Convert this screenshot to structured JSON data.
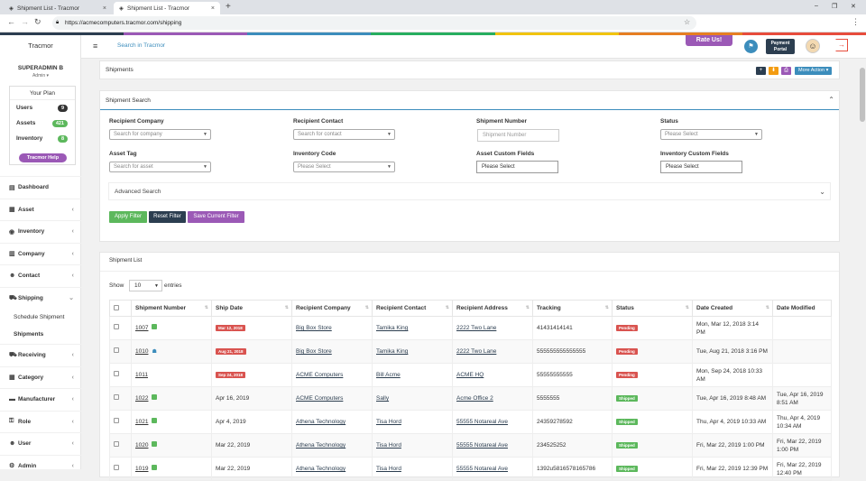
{
  "browser": {
    "tabs": [
      {
        "title": "Shipment List - Tracmor",
        "close": "×"
      },
      {
        "title": "Shipment List - Tracmor",
        "close": "×"
      }
    ],
    "new_tab": "+",
    "url": "https://acmecomputers.tracmor.com/shipping",
    "window_controls": [
      "–",
      "❐",
      "✕"
    ]
  },
  "sidebar": {
    "brand": "Tracmor",
    "user_name": "SUPERADMIN B",
    "user_role": "Admin ▾",
    "plan": {
      "title": "Your Plan",
      "items": [
        {
          "label": "Users",
          "count": "9"
        },
        {
          "label": "Assets",
          "count": "421"
        },
        {
          "label": "Inventory",
          "count": "8"
        }
      ],
      "help_label": "Tracmor Help"
    },
    "nav": [
      {
        "label": "Dashboard",
        "icon": "▤"
      },
      {
        "label": "Asset",
        "icon": "▦"
      },
      {
        "label": "Inventory",
        "icon": "◉"
      },
      {
        "label": "Company",
        "icon": "▥"
      },
      {
        "label": "Contact",
        "icon": "☻"
      },
      {
        "label": "Shipping",
        "icon": "⛟"
      }
    ],
    "shipping_sub": [
      "Schedule Shipment",
      "Shipments"
    ],
    "nav2": [
      {
        "label": "Receiving",
        "icon": "⛟"
      },
      {
        "label": "Category",
        "icon": "▦"
      },
      {
        "label": "Manufacturer",
        "icon": "▬"
      },
      {
        "label": "Role",
        "icon": "⚿"
      },
      {
        "label": "User",
        "icon": "☻"
      },
      {
        "label": "Admin",
        "icon": "⚙"
      }
    ]
  },
  "header": {
    "search": "Search in Tracmor",
    "rate_us": "Rate Us!",
    "payment_portal": "Payment Portal"
  },
  "shipments_bar": {
    "title": "Shipments",
    "more_action": "More Action ▾",
    "action_icons": [
      "+",
      "⬇",
      "⎙",
      "▬"
    ],
    "colors": [
      "#2c3e50",
      "#f39c12",
      "#9b59b6",
      "#9b59b6"
    ]
  },
  "search_panel": {
    "title": "Shipment Search",
    "fields": {
      "recipient_company": {
        "label": "Recipient Company",
        "placeholder": "Search for company"
      },
      "recipient_contact": {
        "label": "Recipient Contact",
        "placeholder": "Search for contact"
      },
      "shipment_number": {
        "label": "Shipment Number",
        "placeholder": "Shipment Number"
      },
      "status": {
        "label": "Status",
        "placeholder": "Please Select"
      },
      "asset_tag": {
        "label": "Asset Tag",
        "placeholder": "Search for asset"
      },
      "inventory_code": {
        "label": "Inventory Code",
        "placeholder": "Please Select"
      },
      "asset_custom": {
        "label": "Asset Custom Fields",
        "value": "Please Select"
      },
      "inventory_custom": {
        "label": "Inventory Custom Fields",
        "value": "Please Select"
      }
    },
    "advanced": "Advanced Search",
    "buttons": {
      "apply": "Apply Filter",
      "reset": "Reset Filter",
      "save": "Save Current Filter"
    }
  },
  "list_panel": {
    "title": "Shipment List",
    "show": "Show",
    "entries_value": "10",
    "entries": "entries",
    "columns": [
      "Shipment Number",
      "Ship Date",
      "Recipient Company",
      "Recipient Contact",
      "Recipient Address",
      "Tracking",
      "Status",
      "Date Created",
      "Date Modified"
    ],
    "rows": [
      {
        "num": "1007",
        "icon": "doc",
        "date": "Mar 12, 2018",
        "overdue": true,
        "company": "Big Box Store",
        "contact": "Tamika King",
        "address": "2222 Two Lane",
        "tracking": "41431414141",
        "status": "Pending",
        "created": "Mon, Mar 12, 2018 3:14 PM",
        "modified": ""
      },
      {
        "num": "1010",
        "icon": "ppl",
        "date": "Aug 21, 2018",
        "overdue": true,
        "company": "Big Box Store",
        "contact": "Tamika King",
        "address": "2222 Two Lane",
        "tracking": "555555555555555",
        "status": "Pending",
        "created": "Tue, Aug 21, 2018 3:16 PM",
        "modified": ""
      },
      {
        "num": "1011",
        "icon": "",
        "date": "Sep 24, 2018",
        "overdue": true,
        "company": "ACME Computers",
        "contact": "Bill Acme",
        "address": "ACME HQ",
        "tracking": "55555555555",
        "status": "Pending",
        "created": "Mon, Sep 24, 2018 10:33 AM",
        "modified": ""
      },
      {
        "num": "1022",
        "icon": "doc",
        "date": "Apr 16, 2019",
        "overdue": false,
        "company": "ACME Computers",
        "contact": "Sally",
        "address": "Acme Office 2",
        "tracking": "5555555",
        "status": "Shipped",
        "created": "Tue, Apr 16, 2019 8:48 AM",
        "modified": "Tue, Apr 16, 2019 8:51 AM"
      },
      {
        "num": "1021",
        "icon": "doc",
        "date": "Apr 4, 2019",
        "overdue": false,
        "company": "Athena Technology",
        "contact": "Tisa Hord",
        "address": "55555 Notareal Ave",
        "tracking": "24359278592",
        "status": "Shipped",
        "created": "Thu, Apr 4, 2019 10:33 AM",
        "modified": "Thu, Apr 4, 2019 10:34 AM"
      },
      {
        "num": "1020",
        "icon": "doc",
        "date": "Mar 22, 2019",
        "overdue": false,
        "company": "Athena Technology",
        "contact": "Tisa Hord",
        "address": "55555 Notareal Ave",
        "tracking": "234525252",
        "status": "Shipped",
        "created": "Fri, Mar 22, 2019 1:00 PM",
        "modified": "Fri, Mar 22, 2019 1:00 PM"
      },
      {
        "num": "1019",
        "icon": "doc",
        "date": "Mar 22, 2019",
        "overdue": false,
        "company": "Athena Technology",
        "contact": "Tisa Hord",
        "address": "55555 Notareal Ave",
        "tracking": "1392u5816578165786",
        "status": "Shipped",
        "created": "Fri, Mar 22, 2019 12:39 PM",
        "modified": "Fri, Mar 22, 2019 12:40 PM"
      }
    ],
    "status_colors": {
      "Pending": "#d9534f",
      "Shipped": "#5cb85c"
    }
  },
  "rainbow_colors": [
    "#2c3e50",
    "#9b59b6",
    "#3c8dbc",
    "#27ae60",
    "#f1c40f",
    "#e67e22",
    "#e74c3c"
  ]
}
